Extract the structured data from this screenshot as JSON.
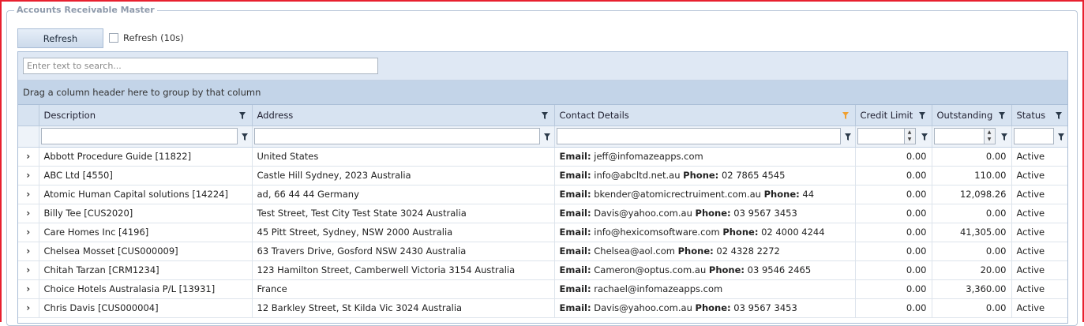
{
  "panel": {
    "title": "Accounts Receivable Master"
  },
  "toolbar": {
    "refresh_label": "Refresh",
    "auto_refresh_label": "Refresh (10s)",
    "auto_refresh_checked": false
  },
  "grid": {
    "search_placeholder": "Enter text to search...",
    "group_panel_text": "Drag a column header here to group by that column",
    "columns": [
      "Description",
      "Address",
      "Contact Details",
      "Credit Limit",
      "Outstanding",
      "Status"
    ],
    "active_filter_column": "Contact Details",
    "email_label": "Email:",
    "phone_label": "Phone:",
    "rows": [
      {
        "description": "Abbott Procedure Guide [11822]",
        "address": "United States",
        "email": "jeff@infomazeapps.com",
        "phone": "",
        "credit_limit": "0.00",
        "outstanding": "0.00",
        "status": "Active"
      },
      {
        "description": "ABC Ltd [4550]",
        "address": "Castle Hill Sydney, 2023 Australia",
        "email": "info@abcltd.net.au",
        "phone": "02 7865 4545",
        "credit_limit": "0.00",
        "outstanding": "110.00",
        "status": "Active"
      },
      {
        "description": "Atomic Human Capital solutions [14224]",
        "address": "ad, 66 44 44 Germany",
        "email": "bkender@atomicrectruiment.com.au",
        "phone": "44",
        "credit_limit": "0.00",
        "outstanding": "12,098.26",
        "status": "Active"
      },
      {
        "description": "Billy Tee [CUS2020]",
        "address": "Test Street, Test City Test State 3024 Australia",
        "email": "Davis@yahoo.com.au",
        "phone": "03 9567 3453",
        "credit_limit": "0.00",
        "outstanding": "0.00",
        "status": "Active"
      },
      {
        "description": "Care Homes Inc [4196]",
        "address": "45 Pitt Street, Sydney, NSW 2000 Australia",
        "email": "info@hexicomsoftware.com",
        "phone": "02 4000 4244",
        "credit_limit": "0.00",
        "outstanding": "41,305.00",
        "status": "Active"
      },
      {
        "description": "Chelsea Mosset [CUS000009]",
        "address": "63 Travers Drive, Gosford NSW 2430 Australia",
        "email": "Chelsea@aol.com",
        "phone": "02 4328 2272",
        "credit_limit": "0.00",
        "outstanding": "0.00",
        "status": "Active"
      },
      {
        "description": "Chitah Tarzan [CRM1234]",
        "address": "123 Hamilton Street, Camberwell Victoria 3154 Australia",
        "email": "Cameron@optus.com.au",
        "phone": "03 9546 2465",
        "credit_limit": "0.00",
        "outstanding": "20.00",
        "status": "Active"
      },
      {
        "description": "Choice Hotels Australasia P/L [13931]",
        "address": "France",
        "email": "rachael@infomazeapps.com",
        "phone": "",
        "credit_limit": "0.00",
        "outstanding": "3,360.00",
        "status": "Active"
      },
      {
        "description": "Chris Davis [CUS000004]",
        "address": "12 Barkley Street, St Kilda Vic 3024 Australia",
        "email": "Davis@yahoo.com.au",
        "phone": "03 9567 3453",
        "credit_limit": "0.00",
        "outstanding": "0.00",
        "status": "Active"
      }
    ]
  },
  "colors": {
    "frame_border": "#e8202f",
    "header_bg": "#d7e3f1",
    "group_panel_bg": "#c3d4e8",
    "filter_icon": "#2b3a4a",
    "active_filter_icon": "#f0a030"
  },
  "icons": {
    "expand": "chevron-right-icon",
    "filter": "funnel-icon",
    "spin": "spin-updown-icon"
  }
}
